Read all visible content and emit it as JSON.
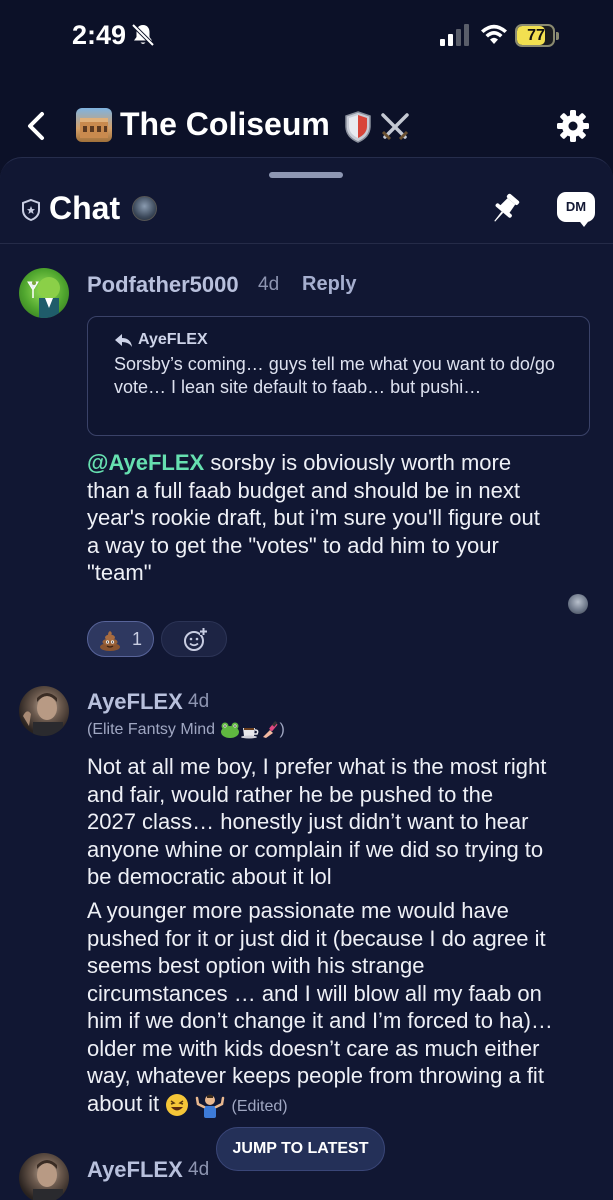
{
  "status_bar": {
    "time": "2:49",
    "battery": "77",
    "battery_level": 0.77
  },
  "header": {
    "title": "The Coliseum"
  },
  "chat": {
    "title": "Chat",
    "dm_label": "DM"
  },
  "messages": [
    {
      "username": "Podfather5000",
      "time": "4d",
      "reply_label": "Reply",
      "quote": {
        "author": "AyeFLEX",
        "text": "Sorsby’s coming… guys tell me what you want to do/go vote… I lean site default to faab… but pushi…"
      },
      "mention": "@AyeFLEX",
      "lines": [
        " sorsby is obviously worth more",
        "than a full faab budget and should be in next",
        "year's rookie draft, but i'm sure you'll figure out",
        "a way to get the \"votes\" to add him to your",
        "\"team\""
      ],
      "reactions": [
        {
          "emoji": "pile-of-poo",
          "count": "1"
        }
      ]
    },
    {
      "username": "AyeFLEX",
      "time": "4d",
      "flair": "(Elite Fantsy Mind",
      "flair_close": ")",
      "paragraph1": [
        "Not at all me boy, I prefer what is the most right",
        "and fair, would rather he be pushed to the",
        "2027 class… honestly just didn’t want to hear",
        "anyone whine or complain if we did so trying to",
        "be democratic about it lol"
      ],
      "paragraph2": [
        "A younger more passionate me would have",
        "pushed for it or just did it (because I do agree it",
        "seems best option with his strange",
        "circumstances … and I will blow all my faab on",
        "him if we don’t change it and I’m forced to ha)…",
        "older me with kids doesn’t care as much either",
        "way, whatever keeps people from throwing a fit"
      ],
      "last_line": "about it",
      "edited": "(Edited)"
    },
    {
      "username": "AyeFLEX",
      "time": "4d"
    }
  ],
  "jump_button": "JUMP TO LATEST"
}
